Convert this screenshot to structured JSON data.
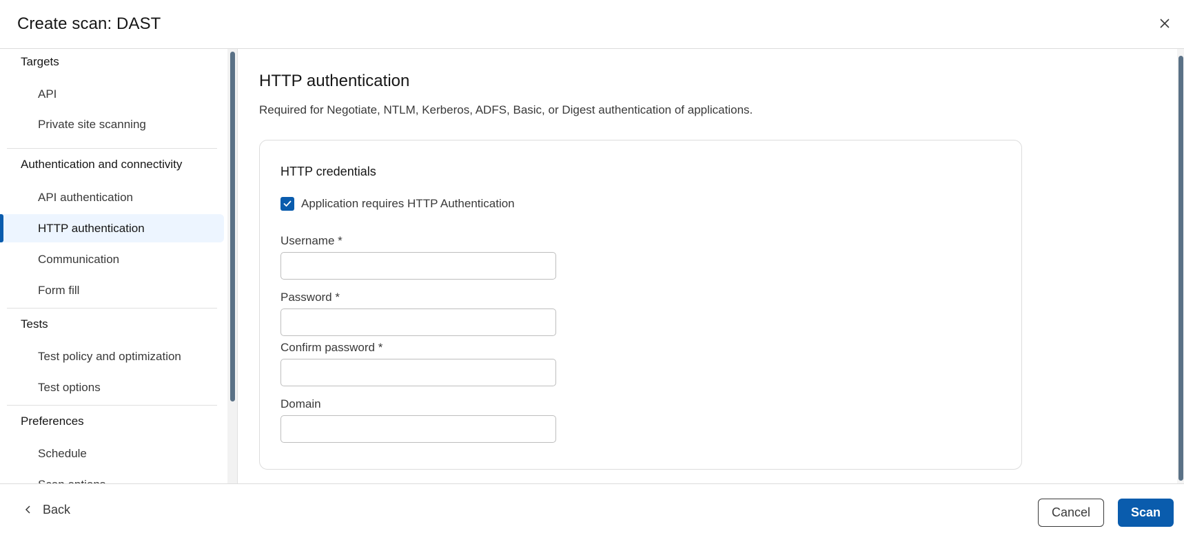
{
  "dialog": {
    "title": "Create scan: DAST",
    "close_icon": "close-icon"
  },
  "sidebar": {
    "sections": [
      {
        "title": "Targets",
        "items": [
          {
            "label": "API",
            "active": false
          },
          {
            "label": "Private site scanning",
            "active": false
          }
        ]
      },
      {
        "title": "Authentication and connectivity",
        "items": [
          {
            "label": "API authentication",
            "active": false
          },
          {
            "label": "HTTP authentication",
            "active": true
          },
          {
            "label": "Communication",
            "active": false
          },
          {
            "label": "Form fill",
            "active": false
          }
        ]
      },
      {
        "title": "Tests",
        "items": [
          {
            "label": "Test policy and optimization",
            "active": false
          },
          {
            "label": "Test options",
            "active": false
          }
        ]
      },
      {
        "title": "Preferences",
        "items": [
          {
            "label": "Schedule",
            "active": false
          },
          {
            "label": "Scan options",
            "active": false
          }
        ]
      }
    ]
  },
  "main": {
    "title": "HTTP authentication",
    "description": "Required for Negotiate, NTLM, Kerberos, ADFS, Basic, or Digest authentication of applications.",
    "card": {
      "title": "HTTP credentials",
      "checkbox": {
        "label": "Application requires HTTP Authentication",
        "checked": true
      },
      "fields": [
        {
          "label": "Username *",
          "value": "",
          "placeholder": ""
        },
        {
          "label": "Password *",
          "value": "",
          "placeholder": ""
        },
        {
          "label": "Confirm password *",
          "value": "",
          "placeholder": ""
        },
        {
          "label": "Domain",
          "value": "",
          "placeholder": ""
        }
      ]
    }
  },
  "footer": {
    "back_label": "Back",
    "cancel_label": "Cancel",
    "scan_label": "Scan"
  },
  "colors": {
    "primary": "#0a5cad",
    "active_nav_bg": "#edf5ff",
    "scrollbar_thumb": "#5a7186"
  }
}
